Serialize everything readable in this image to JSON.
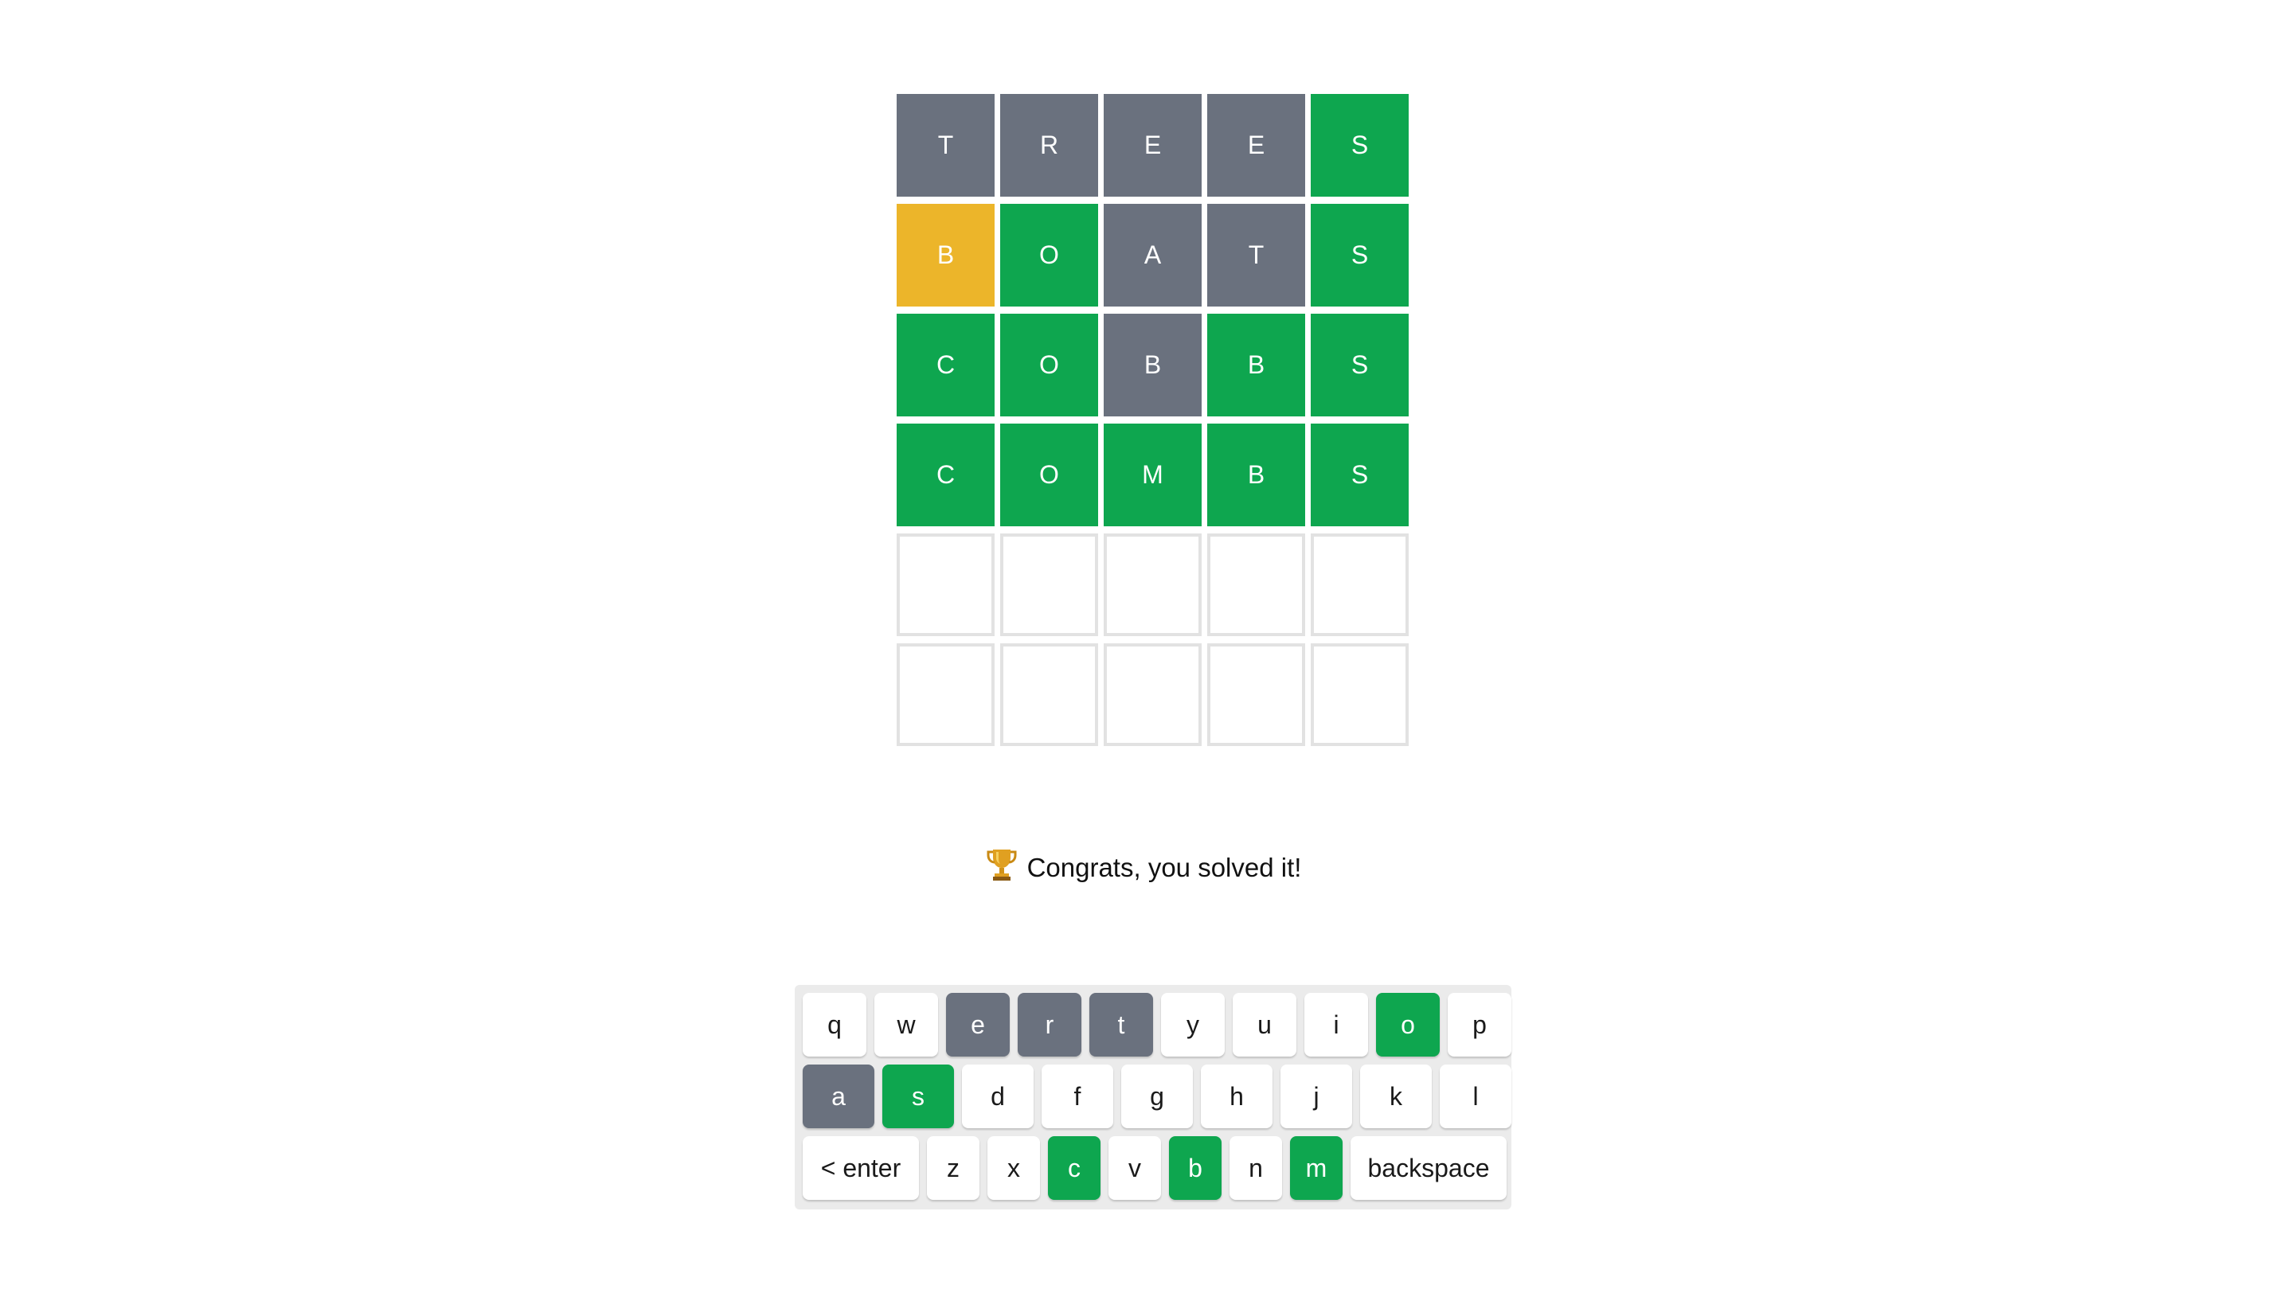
{
  "colors": {
    "correct": "#0ea64f",
    "present": "#ecb52a",
    "absent": "#6a717e",
    "empty_border": "#e2e2e2",
    "keyboard_bg": "#ebebeb"
  },
  "board": {
    "rows": [
      {
        "tiles": [
          {
            "letter": "T",
            "state": "absent"
          },
          {
            "letter": "R",
            "state": "absent"
          },
          {
            "letter": "E",
            "state": "absent"
          },
          {
            "letter": "E",
            "state": "absent"
          },
          {
            "letter": "S",
            "state": "correct"
          }
        ]
      },
      {
        "tiles": [
          {
            "letter": "B",
            "state": "present"
          },
          {
            "letter": "O",
            "state": "correct"
          },
          {
            "letter": "A",
            "state": "absent"
          },
          {
            "letter": "T",
            "state": "absent"
          },
          {
            "letter": "S",
            "state": "correct"
          }
        ]
      },
      {
        "tiles": [
          {
            "letter": "C",
            "state": "correct"
          },
          {
            "letter": "O",
            "state": "correct"
          },
          {
            "letter": "B",
            "state": "absent"
          },
          {
            "letter": "B",
            "state": "correct"
          },
          {
            "letter": "S",
            "state": "correct"
          }
        ]
      },
      {
        "tiles": [
          {
            "letter": "C",
            "state": "correct"
          },
          {
            "letter": "O",
            "state": "correct"
          },
          {
            "letter": "M",
            "state": "correct"
          },
          {
            "letter": "B",
            "state": "correct"
          },
          {
            "letter": "S",
            "state": "correct"
          }
        ]
      },
      {
        "tiles": [
          {
            "letter": "",
            "state": "empty"
          },
          {
            "letter": "",
            "state": "empty"
          },
          {
            "letter": "",
            "state": "empty"
          },
          {
            "letter": "",
            "state": "empty"
          },
          {
            "letter": "",
            "state": "empty"
          }
        ]
      },
      {
        "tiles": [
          {
            "letter": "",
            "state": "empty"
          },
          {
            "letter": "",
            "state": "empty"
          },
          {
            "letter": "",
            "state": "empty"
          },
          {
            "letter": "",
            "state": "empty"
          },
          {
            "letter": "",
            "state": "empty"
          }
        ]
      }
    ]
  },
  "message": {
    "icon": "trophy-icon",
    "text": "Congrats, you solved it!"
  },
  "keyboard": {
    "rows": [
      {
        "keys": [
          {
            "label": "q",
            "state": "default"
          },
          {
            "label": "w",
            "state": "default"
          },
          {
            "label": "e",
            "state": "absent"
          },
          {
            "label": "r",
            "state": "absent"
          },
          {
            "label": "t",
            "state": "absent"
          },
          {
            "label": "y",
            "state": "default"
          },
          {
            "label": "u",
            "state": "default"
          },
          {
            "label": "i",
            "state": "default"
          },
          {
            "label": "o",
            "state": "correct"
          },
          {
            "label": "p",
            "state": "default"
          }
        ]
      },
      {
        "keys": [
          {
            "label": "a",
            "state": "absent"
          },
          {
            "label": "s",
            "state": "correct"
          },
          {
            "label": "d",
            "state": "default"
          },
          {
            "label": "f",
            "state": "default"
          },
          {
            "label": "g",
            "state": "default"
          },
          {
            "label": "h",
            "state": "default"
          },
          {
            "label": "j",
            "state": "default"
          },
          {
            "label": "k",
            "state": "default"
          },
          {
            "label": "l",
            "state": "default"
          }
        ]
      },
      {
        "keys": [
          {
            "label": "< enter",
            "state": "default",
            "kind": "enter"
          },
          {
            "label": "z",
            "state": "default"
          },
          {
            "label": "x",
            "state": "default"
          },
          {
            "label": "c",
            "state": "correct"
          },
          {
            "label": "v",
            "state": "default"
          },
          {
            "label": "b",
            "state": "correct"
          },
          {
            "label": "n",
            "state": "default"
          },
          {
            "label": "m",
            "state": "correct"
          },
          {
            "label": "backspace",
            "state": "default",
            "kind": "backspace"
          }
        ]
      }
    ]
  }
}
